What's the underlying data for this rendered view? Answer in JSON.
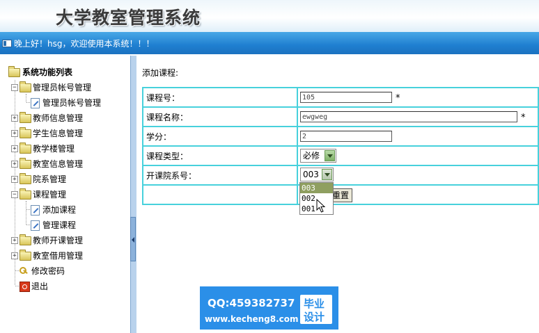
{
  "header": {
    "title": "大学教室管理系统"
  },
  "welcome": {
    "text": "晚上好！hsg，欢迎使用本系统！！！"
  },
  "sidebar": {
    "root": "系统功能列表",
    "items": [
      {
        "label": "管理员帐号管理"
      },
      {
        "label": "管理员帐号管理"
      },
      {
        "label": "教师信息管理"
      },
      {
        "label": "学生信息管理"
      },
      {
        "label": "教学楼管理"
      },
      {
        "label": "教室信息管理"
      },
      {
        "label": "院系管理"
      },
      {
        "label": "课程管理"
      },
      {
        "label": "添加课程"
      },
      {
        "label": "管理课程"
      },
      {
        "label": "教师开课管理"
      },
      {
        "label": "教室借用管理"
      },
      {
        "label": "修改密码"
      },
      {
        "label": "退出"
      }
    ]
  },
  "form": {
    "heading": "添加课程:",
    "course_no_label": "课程号：",
    "course_no_value": "105",
    "course_name_label": "课程名称：",
    "course_name_value": "ewgweg",
    "credit_label": "学分：",
    "credit_value": "2",
    "type_label": "课程类型：",
    "type_value": "必修",
    "dept_label": "开课院系号：",
    "dept_value": "003",
    "required_mark": "*",
    "reset_label": "重置"
  },
  "dropdown": {
    "options": [
      "003",
      "002",
      "001"
    ],
    "selected": "003"
  },
  "watermark": {
    "qq": "QQ:459382737",
    "url": "www.kecheng8.com",
    "badge_1": "毕业",
    "badge_2": "设计"
  }
}
